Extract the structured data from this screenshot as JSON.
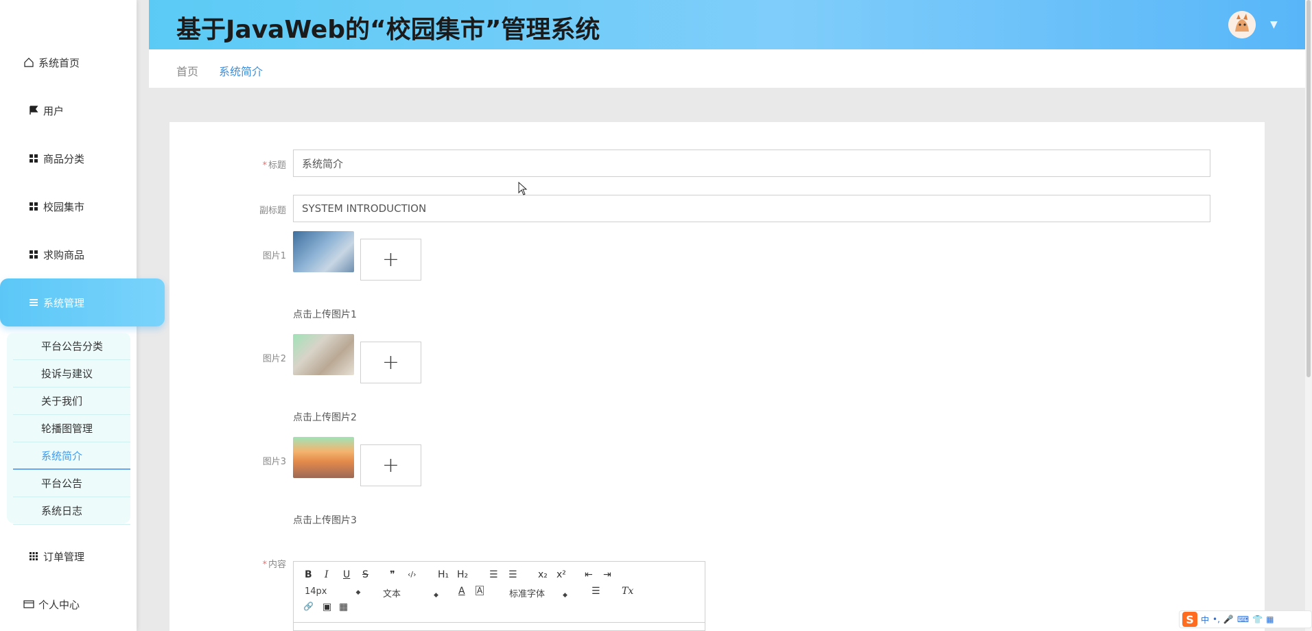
{
  "header": {
    "title": "基于JavaWeb的“校园集市”管理系统"
  },
  "breadcrumb": {
    "home": "首页",
    "current": "系统简介"
  },
  "sidebar": {
    "items": [
      {
        "label": "系统首页",
        "icon": "home-icon"
      },
      {
        "label": "用户",
        "icon": "flag-icon"
      },
      {
        "label": "商品分类",
        "icon": "grid-icon"
      },
      {
        "label": "校园集市",
        "icon": "grid-icon"
      },
      {
        "label": "求购商品",
        "icon": "grid-icon"
      },
      {
        "label": "系统管理",
        "icon": "menu-icon",
        "active": true
      },
      {
        "label": "订单管理",
        "icon": "apps-icon"
      },
      {
        "label": "个人中心",
        "icon": "card-icon"
      }
    ],
    "submenu": [
      {
        "label": "平台公告分类"
      },
      {
        "label": "投诉与建议"
      },
      {
        "label": "关于我们"
      },
      {
        "label": "轮播图管理"
      },
      {
        "label": "系统简介",
        "current": true
      },
      {
        "label": "平台公告"
      },
      {
        "label": "系统日志"
      }
    ]
  },
  "form": {
    "title": {
      "label": "标题",
      "required": "*",
      "value": "系统简介"
    },
    "subtitle": {
      "label": "副标题",
      "value": "SYSTEM INTRODUCTION"
    },
    "picture1": {
      "label": "图片1",
      "hint": "点击上传图片1",
      "add": "+"
    },
    "picture2": {
      "label": "图片2",
      "hint": "点击上传图片2",
      "add": "+"
    },
    "picture3": {
      "label": "图片3",
      "hint": "点击上传图片3",
      "add": "+"
    },
    "content": {
      "label": "内容",
      "required": "*"
    }
  },
  "editor": {
    "toolbar": {
      "bold": "B",
      "italic": "I",
      "underline": "U",
      "strike": "S",
      "quote": "❞",
      "code": "‹/›",
      "h1": "H₁",
      "h2": "H₂",
      "ordered": "☰",
      "bullet": "☰",
      "sub": "x₂",
      "sup": "x²",
      "outdent": "⇤",
      "indent": "⇥",
      "size": "14px",
      "type": "文本",
      "font": "标准字体",
      "color": "A",
      "bg": "A",
      "align": "☰",
      "clean": "Tx",
      "link": "🔗",
      "image": "▣",
      "video": "▦"
    }
  },
  "ime": {
    "mode": "中"
  },
  "colors": {
    "accent": "#3c8edc",
    "required": "#f56c6c",
    "header_start": "#5bcbf5",
    "header_end": "#58b6f8"
  }
}
